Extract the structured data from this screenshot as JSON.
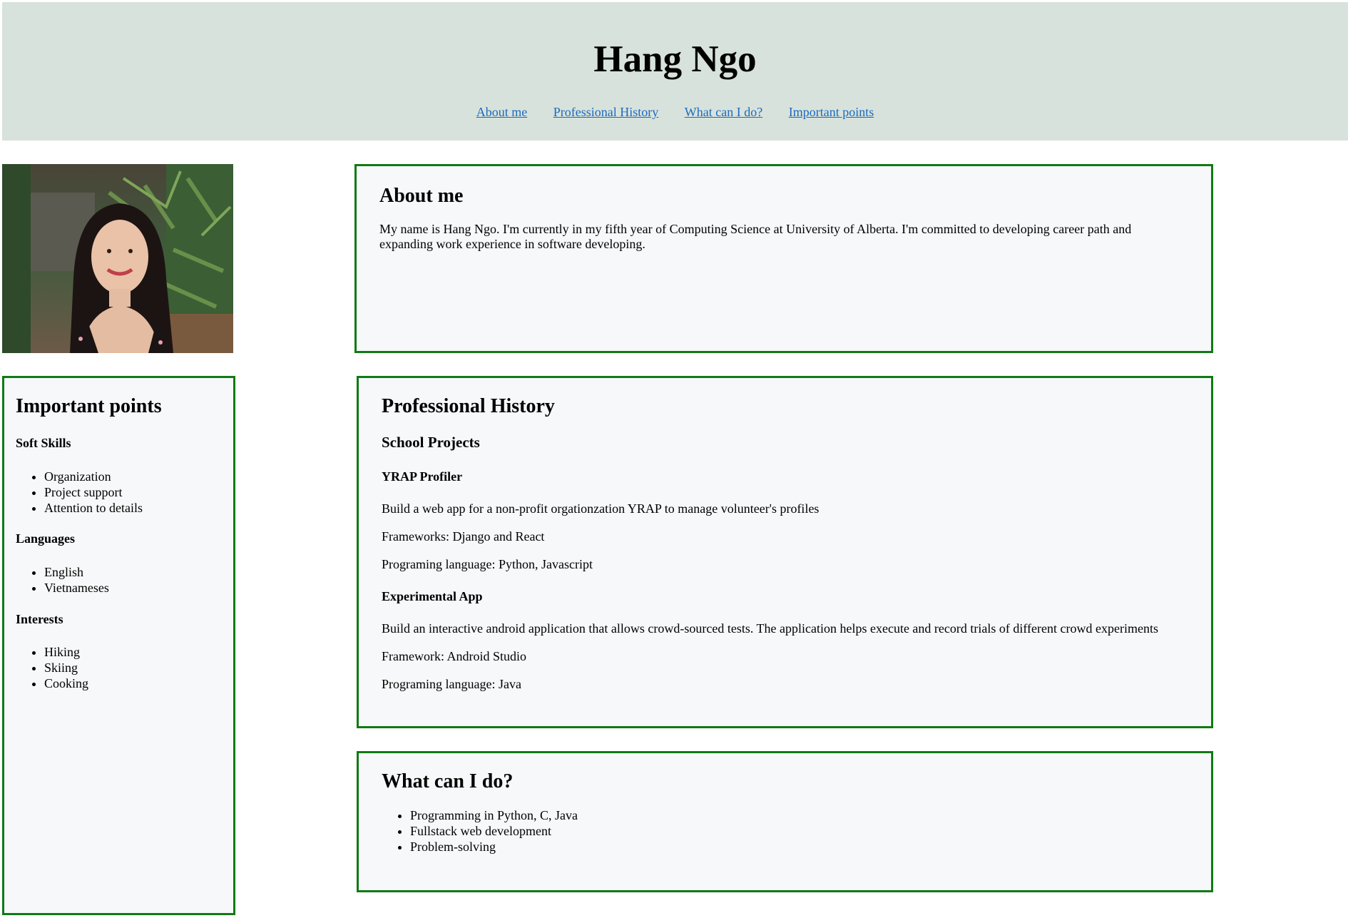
{
  "header": {
    "title": "Hang Ngo",
    "nav": [
      "About me",
      "Professional History",
      "What can I do?",
      "Important points"
    ]
  },
  "about": {
    "heading": "About me",
    "text": "My name is Hang Ngo. I'm currently in my fifth year of Computing Science at University of Alberta. I'm committed to developing career path and expanding work experience in software developing."
  },
  "history": {
    "heading": "Professional History",
    "subheading": "School Projects",
    "projects": [
      {
        "name": "YRAP Profiler",
        "lines": [
          "Build a web app for a non-profit orgationzation YRAP to manage volunteer's profiles",
          "Frameworks: Django and React",
          "Programing language: Python, Javascript"
        ]
      },
      {
        "name": "Experimental App",
        "lines": [
          "Build an interactive android application that allows crowd-sourced tests. The application helps execute and record trials of different crowd experiments",
          "Framework: Android Studio",
          "Programing language: Java"
        ]
      }
    ]
  },
  "whatcan": {
    "heading": "What can I do?",
    "items": [
      "Programming in Python, C, Java",
      "Fullstack web development",
      "Problem-solving"
    ]
  },
  "points": {
    "heading": "Important points",
    "soft_label": "Soft Skills",
    "soft": [
      "Organization",
      "Project support",
      "Attention to details"
    ],
    "lang_label": "Languages",
    "langs": [
      "English",
      "Vietnameses"
    ],
    "int_label": "Interests",
    "interests": [
      "Hiking",
      "Skiing",
      "Cooking"
    ]
  },
  "colors": {
    "header_bg": "#d8e2dc",
    "panel_border": "#0f7a14",
    "link": "#1a6bbf"
  }
}
